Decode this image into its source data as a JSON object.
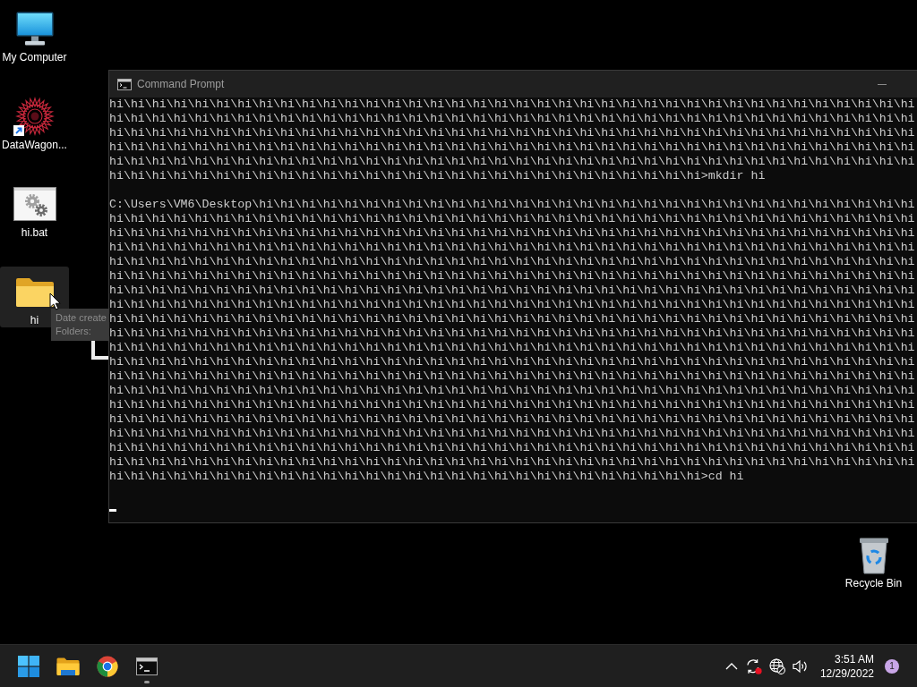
{
  "desktop_icons": [
    {
      "label": "My Computer",
      "kind": "computer",
      "selected": false
    },
    {
      "label": "DataWagon...",
      "kind": "shortcut",
      "selected": false
    },
    {
      "label": "hi.bat",
      "kind": "batch",
      "selected": false
    },
    {
      "label": "hi",
      "kind": "folder",
      "selected": true
    }
  ],
  "tooltip": {
    "lines": [
      "Date create",
      "Folders:"
    ]
  },
  "console": {
    "title": "Command Prompt",
    "focused": false,
    "blocks": [
      {
        "lines": [
          "hi\\hi\\hi\\hi\\hi\\hi\\hi\\hi\\hi\\hi\\hi\\hi\\hi\\hi\\hi\\hi\\hi\\hi\\hi\\hi\\hi\\hi\\hi\\hi\\hi\\hi\\hi\\hi\\hi\\hi\\hi\\hi\\hi\\hi\\hi\\hi\\hi\\hi",
          "hi\\hi\\hi\\hi\\hi\\hi\\hi\\hi\\hi\\hi\\hi\\hi\\hi\\hi\\hi\\hi\\hi\\hi\\hi\\hi\\hi\\hi\\hi\\hi\\hi\\hi\\hi\\hi\\hi\\hi\\hi\\hi\\hi\\hi\\hi\\hi\\hi\\hi",
          "hi\\hi\\hi\\hi\\hi\\hi\\hi\\hi\\hi\\hi\\hi\\hi\\hi\\hi\\hi\\hi\\hi\\hi\\hi\\hi\\hi\\hi\\hi\\hi\\hi\\hi\\hi\\hi\\hi\\hi\\hi\\hi\\hi\\hi\\hi\\hi\\hi\\hi",
          "hi\\hi\\hi\\hi\\hi\\hi\\hi\\hi\\hi\\hi\\hi\\hi\\hi\\hi\\hi\\hi\\hi\\hi\\hi\\hi\\hi\\hi\\hi\\hi\\hi\\hi\\hi\\hi\\hi\\hi\\hi\\hi\\hi\\hi\\hi\\hi\\hi\\hi",
          "hi\\hi\\hi\\hi\\hi\\hi\\hi\\hi\\hi\\hi\\hi\\hi\\hi\\hi\\hi\\hi\\hi\\hi\\hi\\hi\\hi\\hi\\hi\\hi\\hi\\hi\\hi\\hi\\hi\\hi\\hi\\hi\\hi\\hi\\hi\\hi\\hi\\hi",
          "hi\\hi\\hi\\hi\\hi\\hi\\hi\\hi\\hi\\hi\\hi\\hi\\hi\\hi\\hi\\hi\\hi\\hi\\hi\\hi\\hi\\hi\\hi\\hi\\hi\\hi\\hi\\hi>mkdir hi"
        ]
      },
      {
        "lines": [
          "C:\\Users\\VM6\\Desktop\\hi\\hi\\hi\\hi\\hi\\hi\\hi\\hi\\hi\\hi\\hi\\hi\\hi\\hi\\hi\\hi\\hi\\hi\\hi\\hi\\hi\\hi\\hi\\hi\\hi\\hi\\hi\\hi\\hi\\hi\\hi",
          "hi\\hi\\hi\\hi\\hi\\hi\\hi\\hi\\hi\\hi\\hi\\hi\\hi\\hi\\hi\\hi\\hi\\hi\\hi\\hi\\hi\\hi\\hi\\hi\\hi\\hi\\hi\\hi\\hi\\hi\\hi\\hi\\hi\\hi\\hi\\hi\\hi\\hi",
          "hi\\hi\\hi\\hi\\hi\\hi\\hi\\hi\\hi\\hi\\hi\\hi\\hi\\hi\\hi\\hi\\hi\\hi\\hi\\hi\\hi\\hi\\hi\\hi\\hi\\hi\\hi\\hi\\hi\\hi\\hi\\hi\\hi\\hi\\hi\\hi\\hi\\hi",
          "hi\\hi\\hi\\hi\\hi\\hi\\hi\\hi\\hi\\hi\\hi\\hi\\hi\\hi\\hi\\hi\\hi\\hi\\hi\\hi\\hi\\hi\\hi\\hi\\hi\\hi\\hi\\hi\\hi\\hi\\hi\\hi\\hi\\hi\\hi\\hi\\hi\\hi",
          "hi\\hi\\hi\\hi\\hi\\hi\\hi\\hi\\hi\\hi\\hi\\hi\\hi\\hi\\hi\\hi\\hi\\hi\\hi\\hi\\hi\\hi\\hi\\hi\\hi\\hi\\hi\\hi\\hi\\hi\\hi\\hi\\hi\\hi\\hi\\hi\\hi\\hi",
          "hi\\hi\\hi\\hi\\hi\\hi\\hi\\hi\\hi\\hi\\hi\\hi\\hi\\hi\\hi\\hi\\hi\\hi\\hi\\hi\\hi\\hi\\hi\\hi\\hi\\hi\\hi\\hi\\hi\\hi\\hi\\hi\\hi\\hi\\hi\\hi\\hi\\hi",
          "hi\\hi\\hi\\hi\\hi\\hi\\hi\\hi\\hi\\hi\\hi\\hi\\hi\\hi\\hi\\hi\\hi\\hi\\hi\\hi\\hi\\hi\\hi\\hi\\hi\\hi\\hi\\hi\\hi\\hi\\hi\\hi\\hi\\hi\\hi\\hi\\hi\\hi",
          "hi\\hi\\hi\\hi\\hi\\hi\\hi\\hi\\hi\\hi\\hi\\hi\\hi\\hi\\hi\\hi\\hi\\hi\\hi\\hi\\hi\\hi\\hi\\hi\\hi\\hi\\hi\\hi\\hi\\hi\\hi\\hi\\hi\\hi\\hi\\hi\\hi\\hi",
          "hi\\hi\\hi\\hi\\hi\\hi\\hi\\hi\\hi\\hi\\hi\\hi\\hi\\hi\\hi\\hi\\hi\\hi\\hi\\hi\\hi\\hi\\hi\\hi\\hi\\hi\\hi\\hi\\hi\\hi\\hi\\hi\\hi\\hi\\hi\\hi\\hi\\hi",
          "hi\\hi\\hi\\hi\\hi\\hi\\hi\\hi\\hi\\hi\\hi\\hi\\hi\\hi\\hi\\hi\\hi\\hi\\hi\\hi\\hi\\hi\\hi\\hi\\hi\\hi\\hi\\hi\\hi\\hi\\hi\\hi\\hi\\hi\\hi\\hi\\hi\\hi",
          "hi\\hi\\hi\\hi\\hi\\hi\\hi\\hi\\hi\\hi\\hi\\hi\\hi\\hi\\hi\\hi\\hi\\hi\\hi\\hi\\hi\\hi\\hi\\hi\\hi\\hi\\hi\\hi\\hi\\hi\\hi\\hi\\hi\\hi\\hi\\hi\\hi\\hi",
          "hi\\hi\\hi\\hi\\hi\\hi\\hi\\hi\\hi\\hi\\hi\\hi\\hi\\hi\\hi\\hi\\hi\\hi\\hi\\hi\\hi\\hi\\hi\\hi\\hi\\hi\\hi\\hi\\hi\\hi\\hi\\hi\\hi\\hi\\hi\\hi\\hi\\hi",
          "hi\\hi\\hi\\hi\\hi\\hi\\hi\\hi\\hi\\hi\\hi\\hi\\hi\\hi\\hi\\hi\\hi\\hi\\hi\\hi\\hi\\hi\\hi\\hi\\hi\\hi\\hi\\hi\\hi\\hi\\hi\\hi\\hi\\hi\\hi\\hi\\hi\\hi",
          "hi\\hi\\hi\\hi\\hi\\hi\\hi\\hi\\hi\\hi\\hi\\hi\\hi\\hi\\hi\\hi\\hi\\hi\\hi\\hi\\hi\\hi\\hi\\hi\\hi\\hi\\hi\\hi\\hi\\hi\\hi\\hi\\hi\\hi\\hi\\hi\\hi\\hi",
          "hi\\hi\\hi\\hi\\hi\\hi\\hi\\hi\\hi\\hi\\hi\\hi\\hi\\hi\\hi\\hi\\hi\\hi\\hi\\hi\\hi\\hi\\hi\\hi\\hi\\hi\\hi\\hi\\hi\\hi\\hi\\hi\\hi\\hi\\hi\\hi\\hi\\hi",
          "hi\\hi\\hi\\hi\\hi\\hi\\hi\\hi\\hi\\hi\\hi\\hi\\hi\\hi\\hi\\hi\\hi\\hi\\hi\\hi\\hi\\hi\\hi\\hi\\hi\\hi\\hi\\hi\\hi\\hi\\hi\\hi\\hi\\hi\\hi\\hi\\hi\\hi",
          "hi\\hi\\hi\\hi\\hi\\hi\\hi\\hi\\hi\\hi\\hi\\hi\\hi\\hi\\hi\\hi\\hi\\hi\\hi\\hi\\hi\\hi\\hi\\hi\\hi\\hi\\hi\\hi\\hi\\hi\\hi\\hi\\hi\\hi\\hi\\hi\\hi\\hi",
          "hi\\hi\\hi\\hi\\hi\\hi\\hi\\hi\\hi\\hi\\hi\\hi\\hi\\hi\\hi\\hi\\hi\\hi\\hi\\hi\\hi\\hi\\hi\\hi\\hi\\hi\\hi\\hi\\hi\\hi\\hi\\hi\\hi\\hi\\hi\\hi\\hi\\hi",
          "hi\\hi\\hi\\hi\\hi\\hi\\hi\\hi\\hi\\hi\\hi\\hi\\hi\\hi\\hi\\hi\\hi\\hi\\hi\\hi\\hi\\hi\\hi\\hi\\hi\\hi\\hi\\hi\\hi\\hi\\hi\\hi\\hi\\hi\\hi\\hi\\hi\\hi",
          "hi\\hi\\hi\\hi\\hi\\hi\\hi\\hi\\hi\\hi\\hi\\hi\\hi\\hi\\hi\\hi\\hi\\hi\\hi\\hi\\hi\\hi\\hi\\hi\\hi\\hi\\hi\\hi>cd hi"
        ]
      }
    ],
    "cursor": true
  },
  "recycle_bin": {
    "label": "Recycle Bin",
    "selected": false
  },
  "taskbar": {
    "apps": [
      {
        "kind": "start",
        "running": false
      },
      {
        "kind": "files",
        "running": false
      },
      {
        "kind": "browser",
        "running": false
      },
      {
        "kind": "terminal",
        "running": true
      }
    ],
    "time": "3:51 AM",
    "date": "12/29/2022",
    "notifications": "1"
  }
}
